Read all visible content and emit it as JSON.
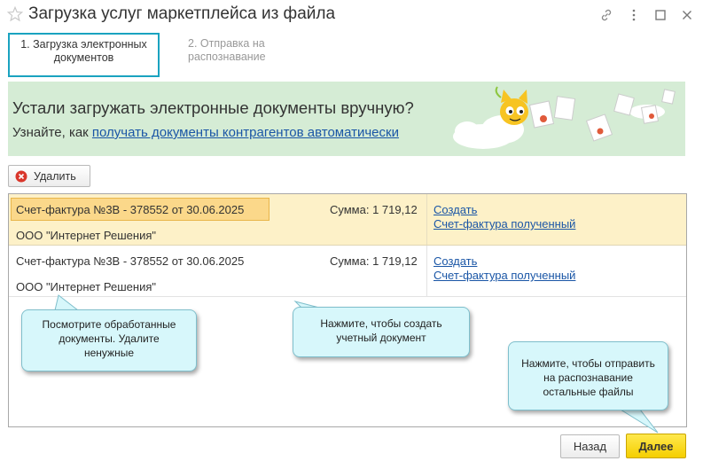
{
  "window": {
    "title": "Загрузка услуг маркетплейса из файла",
    "icons": [
      "star-icon",
      "link-icon",
      "more-icon",
      "maximize-icon",
      "close-icon"
    ]
  },
  "steps": [
    {
      "label": "1. Загрузка электронных документов",
      "line1": "1. Загрузка электронных",
      "line2": "документов",
      "active": true
    },
    {
      "label": "2. Отправка на распознавание",
      "line1": "2. Отправка на",
      "line2": "распознавание",
      "active": false
    }
  ],
  "banner": {
    "title": "Устали загружать электронные документы вручную?",
    "sub_prefix": "Узнайте, как ",
    "sub_link": "получать документы контрагентов автоматически"
  },
  "toolbar": {
    "delete_label": "Удалить"
  },
  "rows": [
    {
      "document": "Счет-фактура №3В - 378552 от 30.06.2025",
      "sum": "Сумма: 1 719,12",
      "organization": "ООО \"Интернет Решения\"",
      "action": "Создать",
      "doc_type": "Счет-фактура полученный",
      "selected": true
    },
    {
      "document": "Счет-фактура №3В - 378552 от 30.06.2025",
      "sum": "Сумма: 1 719,12",
      "organization": "ООО \"Интернет Решения\"",
      "action": "Создать",
      "doc_type": "Счет-фактура полученный",
      "selected": false
    }
  ],
  "callouts": {
    "review": [
      "Посмотрите обработанные",
      "документы. Удалите",
      "ненужные"
    ],
    "create": [
      "Нажмите, чтобы создать",
      "учетный документ"
    ],
    "send": [
      "Нажмите, чтобы отправить",
      "на распознавание",
      "остальные файлы"
    ]
  },
  "footer": {
    "back_label": "Назад",
    "next_label": "Далее"
  },
  "colors": {
    "accent_step": "#1aa3c0",
    "banner_bg": "#d5ecd5",
    "link": "#1a56a6",
    "selected_row": "#fdf1c8",
    "primary_button": "#f5cf00",
    "callout_bg": "#d7f7fb"
  }
}
